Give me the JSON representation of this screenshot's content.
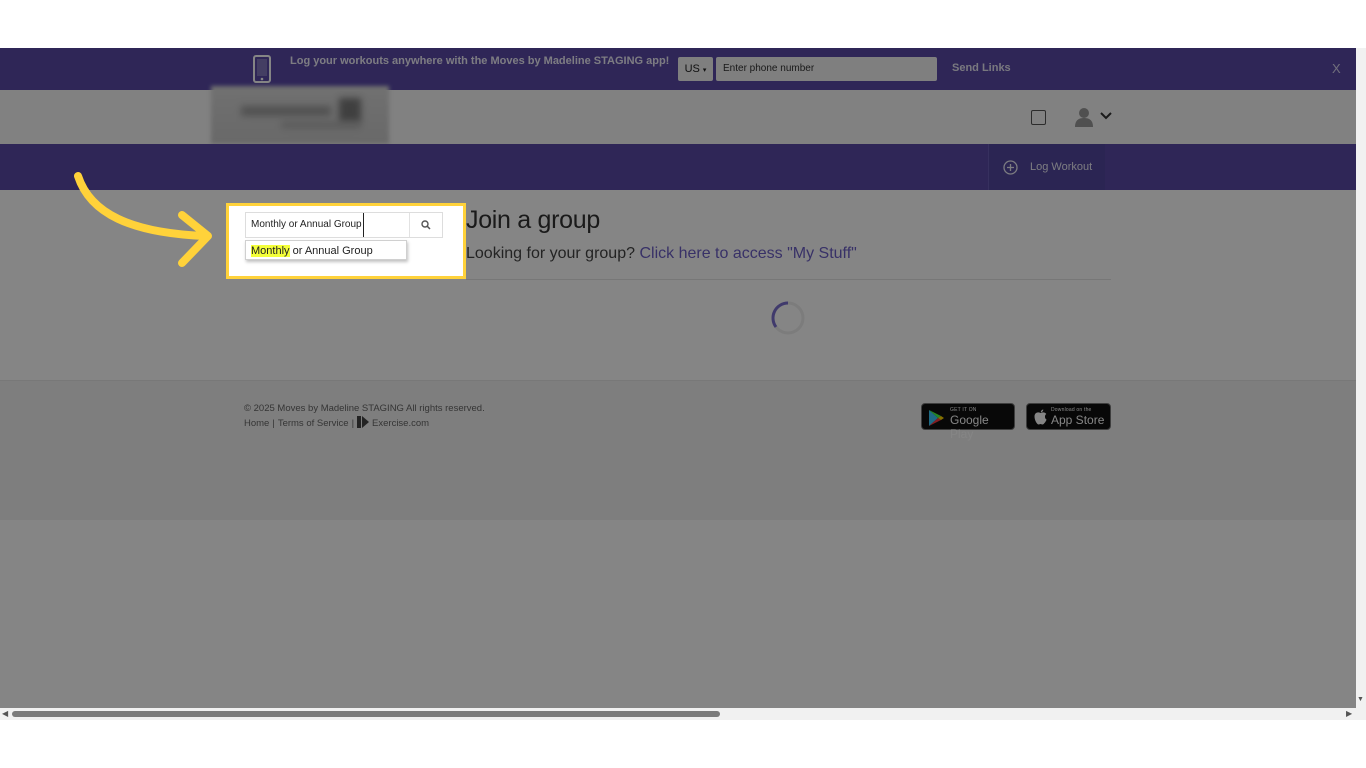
{
  "banner": {
    "text": "Log your workouts anywhere with the Moves by Madeline STAGING app!",
    "country": "US",
    "phone_placeholder": "Enter phone number",
    "send_label": "Send Links",
    "close_label": "X"
  },
  "nav": {
    "log_workout_label": "Log Workout"
  },
  "search": {
    "value": "Monthly or Annual Group",
    "suggestion_match": "Monthly",
    "suggestion_rest": " or Annual Group"
  },
  "main": {
    "title": "Join a group",
    "subtitle_prefix": "Looking for your group? ",
    "subtitle_link": "Click here to access \"My Stuff\""
  },
  "footer": {
    "copyright": "© 2025 Moves by Madeline STAGING All rights reserved.",
    "home_link": "Home",
    "terms_link": "Terms of Service",
    "exercise_link": "Exercise.com",
    "google_play_small": "GET IT ON",
    "google_play_big": "Google Play",
    "app_store_small": "Download on the",
    "app_store_big": "App Store"
  },
  "colors": {
    "brand_purple": "#5a4aa8",
    "highlight_yellow": "#ffd23a",
    "match_highlight": "#f4ff3a",
    "link": "#6b5fc6"
  },
  "icons": [
    "phone-icon",
    "checkbox-icon",
    "user-icon",
    "chevron-down-icon",
    "plus-circle-icon",
    "search-icon",
    "loading-spinner-icon",
    "google-play-icon",
    "apple-icon",
    "exercise-logo-icon",
    "arrow-annotation-icon"
  ]
}
